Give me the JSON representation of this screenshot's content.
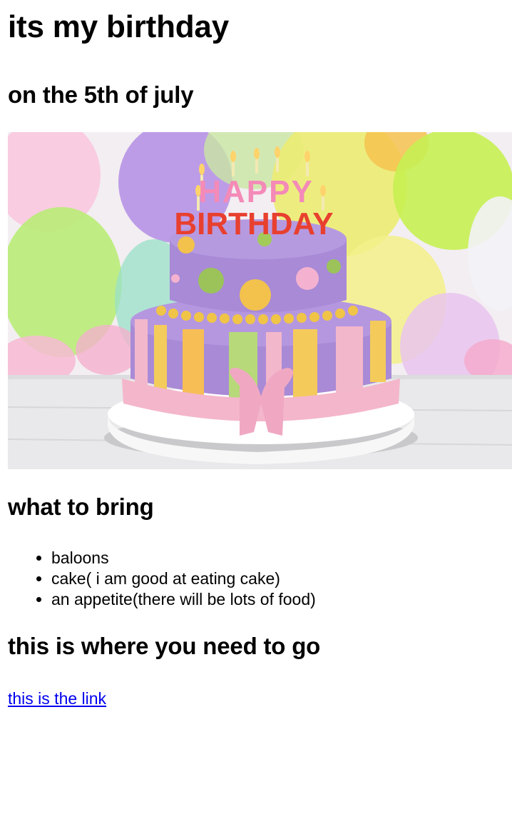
{
  "page": {
    "title": "its my birthday",
    "subtitle": "on the 5th of july"
  },
  "image": {
    "topper_line1": "HAPPY",
    "topper_line2": "BIRTHDAY"
  },
  "bring": {
    "heading": "what to bring",
    "items": [
      "baloons",
      "cake( i am good at eating cake)",
      "an appetite(there will be lots of food)"
    ]
  },
  "location": {
    "heading": "this is where you need to go",
    "link_text": "this is the link"
  }
}
